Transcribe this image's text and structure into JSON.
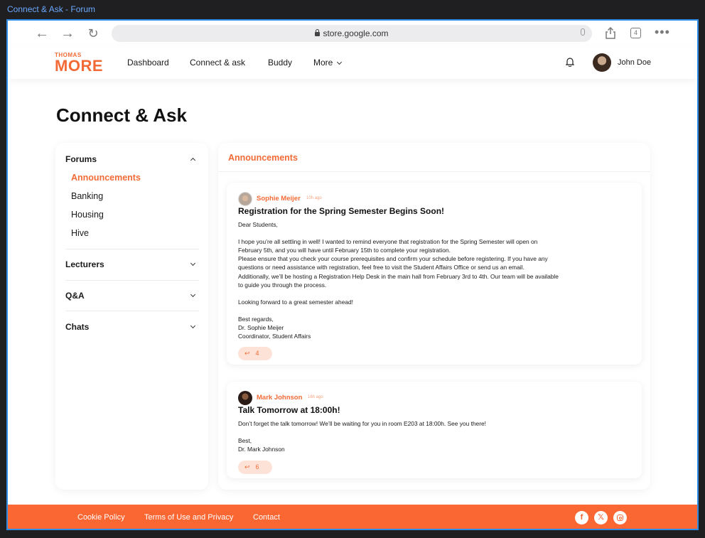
{
  "window": {
    "title": "Connect & Ask - Forum"
  },
  "browser": {
    "back_icon": "arrow-left-icon",
    "forward_icon": "arrow-right-icon",
    "reload_icon": "reload-icon",
    "url": "store.google.com",
    "tab_count": "4"
  },
  "header": {
    "logo_top": "THOMAS",
    "logo_main": "MORE",
    "nav": [
      "Dashboard",
      "Connect & ask",
      "Buddy",
      "More"
    ],
    "user_name": "John Doe"
  },
  "page": {
    "title": "Connect & Ask"
  },
  "sidebar": {
    "forums_label": "Forums",
    "forums_items": [
      "Announcements",
      "Banking",
      "Housing",
      "Hive"
    ],
    "lecturers_label": "Lecturers",
    "qa_label": "Q&A",
    "chats_label": "Chats"
  },
  "main": {
    "panel_title": "Announcements",
    "posts": [
      {
        "author": "Sophie Meijer",
        "time": "10h ago",
        "title": "Registration for the Spring Semester Begins Soon!",
        "body": "Dear Students,\n\nI hope you’re all settling in well! I wanted to remind everyone that registration for the Spring Semester will open on\nFebruary 5th, and you will have until February 15th to complete your registration.\nPlease ensure that you check your course prerequisites and confirm your schedule before registering. If you have any\nquestions or need assistance with registration, feel free to visit the Student Affairs Office or send us an email.\nAdditionally, we’ll be hosting a Registration Help Desk in the main hall from February 3rd to 4th. Our team will be available\nto guide you through the process.\n\nLooking forward to a great semester ahead!\n\nBest regards,\nDr. Sophie Meijer\nCoordinator, Student Affairs",
        "replies": "4"
      },
      {
        "author": "Mark Johnson",
        "time": "16h ago",
        "title": "Talk Tomorrow at 18:00h!",
        "body": "Don’t forget the talk tomorrow! We’ll be waiting for you in room E203 at 18:00h. See you there!\n\nBest,\nDr. Mark Johnson",
        "replies": "6"
      }
    ]
  },
  "footer": {
    "links": [
      "Cookie Policy",
      "Terms of Use and Privacy",
      "Contact"
    ],
    "social_icons": [
      "facebook-icon",
      "x-icon",
      "instagram-icon"
    ],
    "colors": {
      "accent": "#f26a36",
      "footer_bg": "#fa6733"
    }
  }
}
